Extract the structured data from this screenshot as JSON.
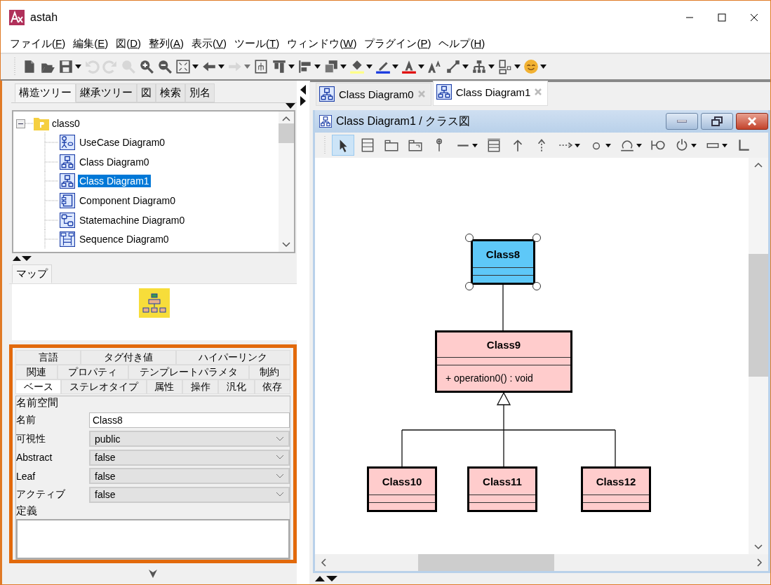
{
  "window": {
    "title": "astah"
  },
  "menu": [
    "ファイル(F)",
    "編集(E)",
    "図(D)",
    "整列(A)",
    "表示(V)",
    "ツール(T)",
    "ウィンドウ(W)",
    "プラグイン(P)",
    "ヘルプ(H)"
  ],
  "toolbar": [
    {
      "kind": "new",
      "disabled": false,
      "dropdown": false
    },
    {
      "kind": "open",
      "disabled": false,
      "dropdown": false
    },
    {
      "kind": "save",
      "disabled": false,
      "dropdown": true
    },
    {
      "kind": "undo",
      "disabled": true,
      "dropdown": false
    },
    {
      "kind": "redo",
      "disabled": true,
      "dropdown": false
    },
    {
      "kind": "zoom-reset",
      "disabled": true,
      "dropdown": false
    },
    {
      "kind": "zoom-in",
      "disabled": false,
      "dropdown": false
    },
    {
      "kind": "zoom-out",
      "disabled": false,
      "dropdown": false
    },
    {
      "kind": "fit",
      "disabled": false,
      "dropdown": true
    },
    {
      "kind": "back",
      "disabled": false,
      "dropdown": true
    },
    {
      "kind": "forward",
      "disabled": true,
      "dropdown": true
    },
    {
      "kind": "layout",
      "disabled": false,
      "dropdown": false
    },
    {
      "kind": "align-top",
      "disabled": false,
      "dropdown": true
    },
    {
      "kind": "align-left",
      "disabled": false,
      "dropdown": true
    },
    {
      "kind": "stack",
      "disabled": false,
      "dropdown": true
    },
    {
      "kind": "fill",
      "disabled": false,
      "dropdown": true
    },
    {
      "kind": "pen",
      "disabled": false,
      "dropdown": true
    },
    {
      "kind": "font-color",
      "disabled": false,
      "dropdown": true
    },
    {
      "kind": "font-size",
      "disabled": false,
      "dropdown": false
    },
    {
      "kind": "line",
      "disabled": false,
      "dropdown": true
    },
    {
      "kind": "tree",
      "disabled": false,
      "dropdown": true
    },
    {
      "kind": "arrange",
      "disabled": false,
      "dropdown": true
    },
    {
      "kind": "smiley",
      "disabled": false,
      "dropdown": true
    }
  ],
  "tree_tabs": [
    {
      "label": "構造ツリー",
      "selected": true
    },
    {
      "label": "継承ツリー",
      "selected": false
    },
    {
      "label": "図",
      "selected": false
    },
    {
      "label": "検索",
      "selected": false
    },
    {
      "label": "別名",
      "selected": false
    }
  ],
  "tree": {
    "label": "class0",
    "expanded": true,
    "children": [
      {
        "label": "UseCase Diagram0",
        "kind": "usecase",
        "selected": false
      },
      {
        "label": "Class Diagram0",
        "kind": "class",
        "selected": false
      },
      {
        "label": "Class Diagram1",
        "kind": "class",
        "selected": true
      },
      {
        "label": "Component Diagram0",
        "kind": "component",
        "selected": false
      },
      {
        "label": "Statemachine Diagram0",
        "kind": "statemachine",
        "selected": false
      },
      {
        "label": "Sequence Diagram0",
        "kind": "sequence",
        "selected": false
      }
    ]
  },
  "map_tab": {
    "label": "マップ"
  },
  "property_tabs": [
    [
      {
        "label": "言語",
        "selected": false
      },
      {
        "label": "タグ付き値",
        "selected": false
      },
      {
        "label": "ハイパーリンク",
        "selected": false
      }
    ],
    [
      {
        "label": "関連",
        "selected": false
      },
      {
        "label": "プロパティ",
        "selected": false
      },
      {
        "label": "テンプレートパラメタ",
        "selected": false
      },
      {
        "label": "制約",
        "selected": false
      }
    ],
    [
      {
        "label": "ベース",
        "selected": true
      },
      {
        "label": "ステレオタイプ",
        "selected": false
      },
      {
        "label": "属性",
        "selected": false
      },
      {
        "label": "操作",
        "selected": false
      },
      {
        "label": "汎化",
        "selected": false
      },
      {
        "label": "依存",
        "selected": false
      }
    ]
  ],
  "properties": {
    "section": "名前空間",
    "fields": [
      {
        "label": "名前",
        "kind": "text",
        "value": "Class8"
      },
      {
        "label": "可視性",
        "kind": "select",
        "value": "public"
      },
      {
        "label": "Abstract",
        "kind": "select",
        "value": "false"
      },
      {
        "label": "Leaf",
        "kind": "select",
        "value": "false"
      },
      {
        "label": "アクティブ",
        "kind": "select",
        "value": "false"
      }
    ],
    "definition_label": "定義"
  },
  "diagram_tabs": [
    {
      "label": "Class Diagram0",
      "selected": false
    },
    {
      "label": "Class Diagram1",
      "selected": true
    }
  ],
  "diagram_window": {
    "title": "Class Diagram1 / クラス図"
  },
  "palette": [
    {
      "kind": "select",
      "selected": true,
      "dropdown": false
    },
    {
      "kind": "class",
      "selected": false,
      "dropdown": false
    },
    {
      "kind": "package",
      "selected": false,
      "dropdown": false
    },
    {
      "kind": "subsystem",
      "selected": false,
      "dropdown": false
    },
    {
      "kind": "pin",
      "selected": false,
      "dropdown": false
    },
    {
      "kind": "association",
      "selected": false,
      "dropdown": true
    },
    {
      "kind": "template",
      "selected": false,
      "dropdown": false
    },
    {
      "kind": "generalization",
      "selected": false,
      "dropdown": false
    },
    {
      "kind": "realization",
      "selected": false,
      "dropdown": false
    },
    {
      "kind": "dependency",
      "selected": false,
      "dropdown": true
    },
    {
      "kind": "ball",
      "selected": false,
      "dropdown": true
    },
    {
      "kind": "socket",
      "selected": false,
      "dropdown": true
    },
    {
      "kind": "provided",
      "selected": false,
      "dropdown": false
    },
    {
      "kind": "required",
      "selected": false,
      "dropdown": true
    },
    {
      "kind": "note",
      "selected": false,
      "dropdown": true
    },
    {
      "kind": "anchor",
      "selected": false,
      "dropdown": false
    }
  ],
  "classes": [
    {
      "name": "Class8",
      "color": "#5ec8f8",
      "selected": true
    },
    {
      "name": "Class9",
      "color": "#ffcccc",
      "selected": false,
      "operations": [
        "+ operation0() : void"
      ]
    },
    {
      "name": "Class10",
      "color": "#ffcccc",
      "selected": false
    },
    {
      "name": "Class11",
      "color": "#ffcccc",
      "selected": false
    },
    {
      "name": "Class12",
      "color": "#ffcccc",
      "selected": false
    }
  ]
}
